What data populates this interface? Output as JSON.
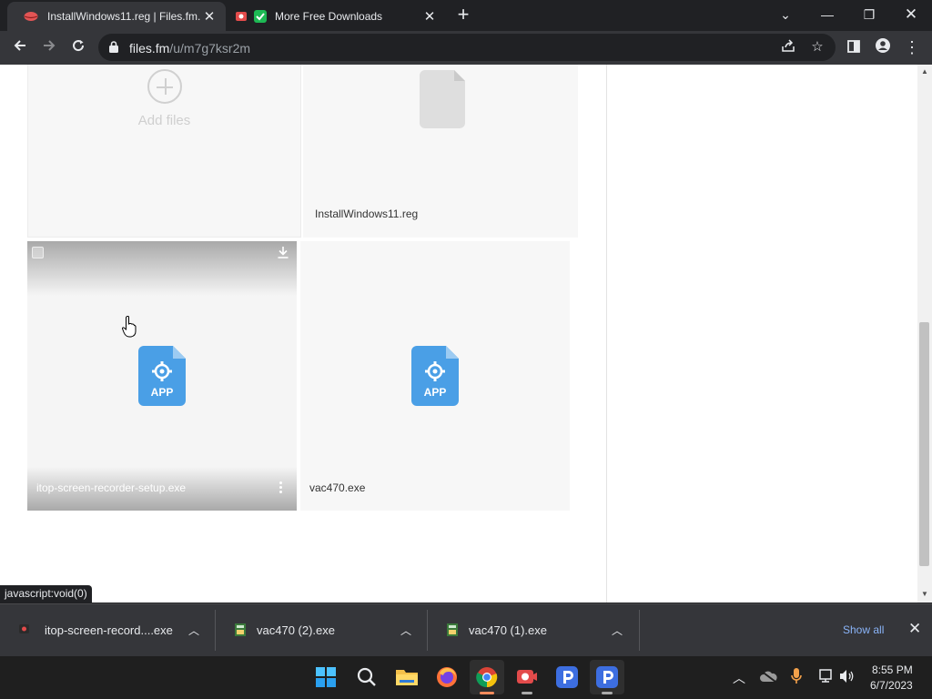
{
  "tabs": [
    {
      "title": "InstallWindows11.reg | Files.fm.",
      "active": true,
      "favicon": "lips-icon"
    },
    {
      "title": "More Free Downloads",
      "active": false,
      "favicon": "check-icon"
    }
  ],
  "toolbar": {
    "url_host": "files.fm",
    "url_path": "/u/m7g7ksr2m"
  },
  "add_card": {
    "label": "Add files"
  },
  "files": [
    {
      "name": "InstallWindows11.reg",
      "type": "generic-file-icon"
    },
    {
      "name": "itop-screen-recorder-setup.exe",
      "type": "app-file-icon",
      "badge": "APP",
      "hovered": true
    },
    {
      "name": "vac470.exe",
      "type": "app-file-icon",
      "badge": "APP"
    }
  ],
  "status_bubble": "javascript:void(0)",
  "downloads": [
    {
      "name": "itop-screen-record....exe"
    },
    {
      "name": "vac470 (2).exe"
    },
    {
      "name": "vac470 (1).exe"
    }
  ],
  "download_shelf": {
    "show_all": "Show all"
  },
  "clock": {
    "time": "8:55 PM",
    "date": "6/7/2023"
  },
  "colors": {
    "app_icon": "#4a9fe6",
    "link": "#8ab4f8",
    "chrome_dark": "#202124",
    "chrome_toolbar": "#35363a"
  }
}
